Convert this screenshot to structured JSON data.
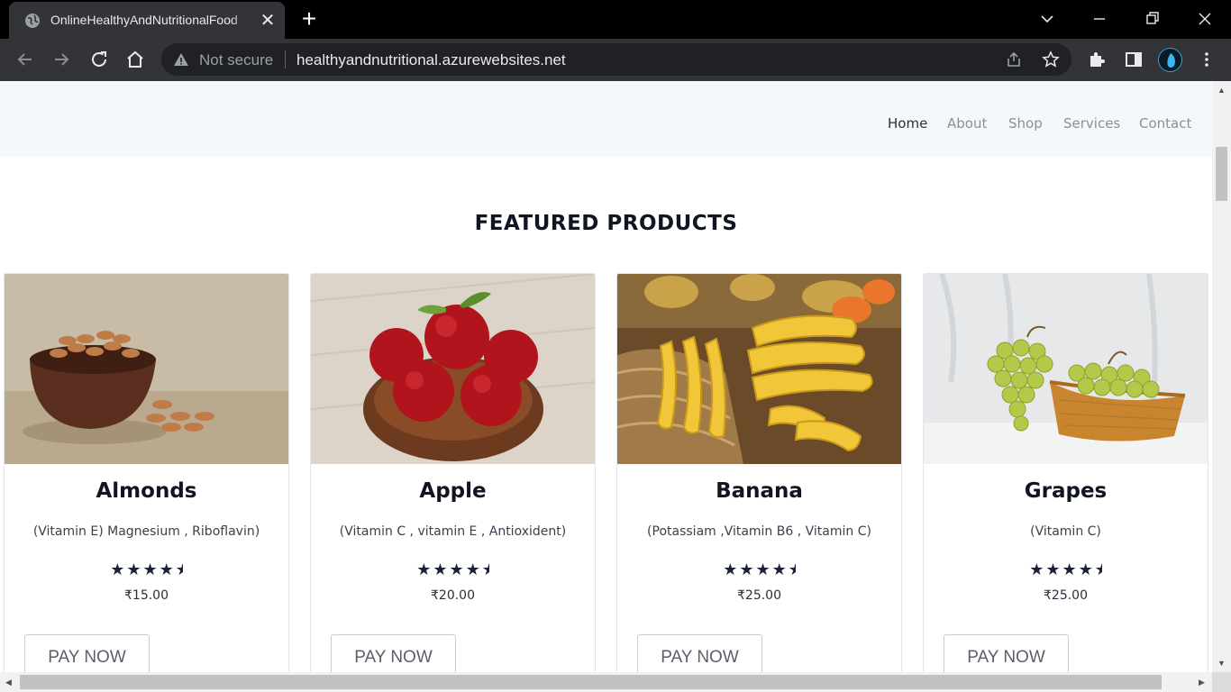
{
  "browser": {
    "tab_title": "OnlineHealthyAndNutritionalFood",
    "tab_close": "✕",
    "new_tab": "+",
    "security_label": "Not secure",
    "url": "healthyandnutritional.azurewebsites.net"
  },
  "site": {
    "nav": [
      {
        "label": "Home",
        "active": true
      },
      {
        "label": "About"
      },
      {
        "label": "Shop"
      },
      {
        "label": "Services"
      },
      {
        "label": "Contact"
      }
    ]
  },
  "featured": {
    "title": "FEATURED PRODUCTS",
    "products": [
      {
        "name": "Almonds",
        "desc": "(Vitamin E) Magnesium , Riboflavin)",
        "rating": 4.5,
        "price": "₹15.00",
        "button": "PAY NOW"
      },
      {
        "name": "Apple",
        "desc": "(Vitamin C , vitamin E , Antioxident)",
        "rating": 4.5,
        "price": "₹20.00",
        "button": "PAY NOW"
      },
      {
        "name": "Banana",
        "desc": "(Potassiam ,Vitamin B6 , Vitamin C)",
        "rating": 4.5,
        "price": "₹25.00",
        "button": "PAY NOW"
      },
      {
        "name": "Grapes",
        "desc": "(Vitamin C)",
        "rating": 4.5,
        "price": "₹25.00",
        "button": "PAY NOW"
      }
    ]
  },
  "colors": {
    "chrome_dark": "#333437",
    "header_bg": "#f5f8fa",
    "title_text": "#111522",
    "star": "#1a2336"
  },
  "icons": [
    "globe-icon",
    "close-icon",
    "plus-icon",
    "chevron-down-icon",
    "minimize-icon",
    "restore-icon",
    "back-icon",
    "forward-icon",
    "reload-icon",
    "home-icon",
    "warning-icon",
    "share-icon",
    "star-icon",
    "extensions-icon",
    "side-panel-icon",
    "menu-icon"
  ]
}
